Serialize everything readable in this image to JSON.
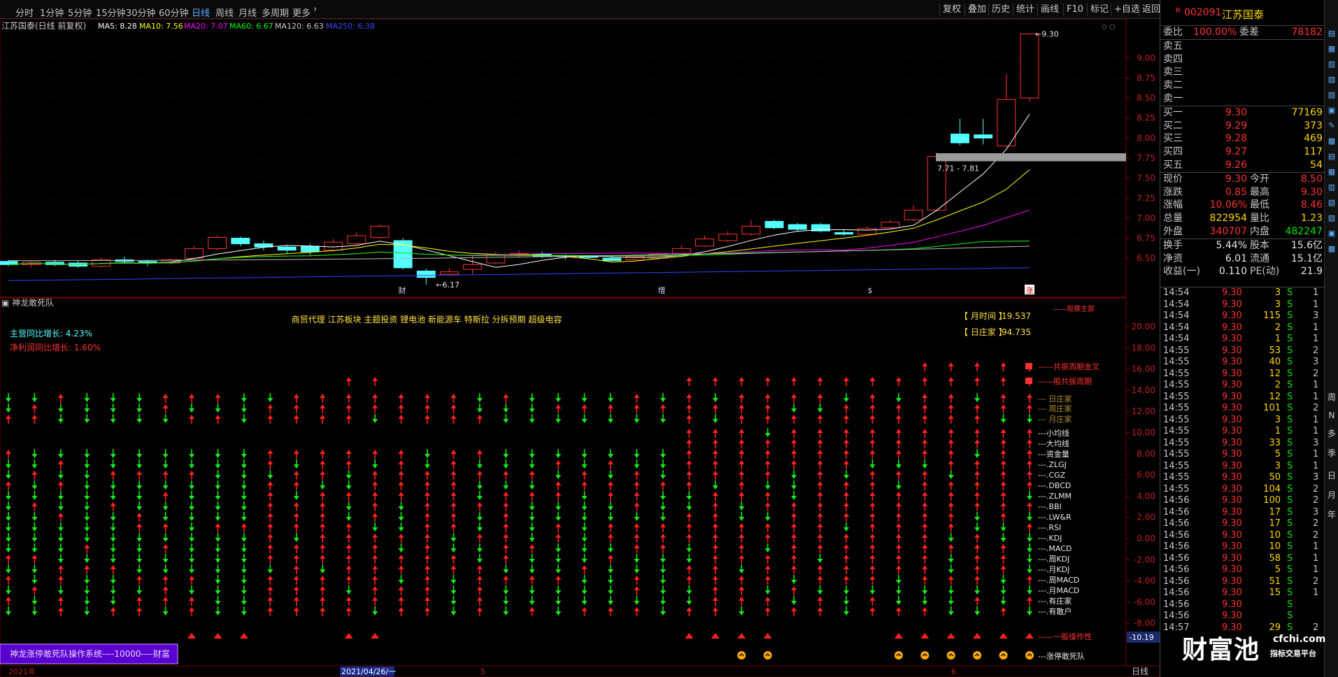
{
  "toolbar": {
    "periods": [
      "分时",
      "1分钟",
      "5分钟",
      "15分钟",
      "30分钟",
      "60分钟",
      "日线",
      "周线",
      "月线",
      "多周期",
      "更多"
    ],
    "active": "日线",
    "buttons": [
      "复权",
      "叠加",
      "历史",
      "统计",
      "画线",
      "F10",
      "标记",
      "+自选",
      "返回"
    ]
  },
  "chart": {
    "title": "江苏国泰(日线 前复权)",
    "ma": [
      {
        "label": "MA5: 8.28",
        "color": "#ffffff"
      },
      {
        "label": "MA10: 7.56",
        "color": "#ffff00"
      },
      {
        "label": "MA20: 7.07",
        "color": "#ff00ff"
      },
      {
        "label": "MA60: 6.67",
        "color": "#00ff00"
      },
      {
        "label": "MA120: 6.63",
        "color": "#cccccc"
      },
      {
        "label": "MA250: 6.38",
        "color": "#4444ff"
      }
    ],
    "price_ticks": [
      "9.00",
      "8.75",
      "8.50",
      "8.25",
      "8.00",
      "7.75",
      "7.50",
      "7.25",
      "7.00",
      "6.75",
      "6.50"
    ],
    "high_label": "9.30",
    "low_label": "6.17",
    "box_label": "7.71 - 7.81",
    "event_marks": [
      "财",
      "增",
      "$",
      "涨"
    ],
    "indicator_name": "神龙敢死队",
    "concepts": "商贸代理 江苏板块 主题投资 锂电池 新能源车 特斯拉 分拆预期 超级电容",
    "growth1": "主营同比增长: 4.23%",
    "growth2": "净利润同比增长: 1.60%",
    "top_right_label": "——观察主部",
    "info1_label": "【 月时间 】",
    "info1_val": "19.537",
    "info2_label": "【 日庄家 】",
    "info2_val": "94.735",
    "lower_ticks": [
      "20.00",
      "18.00",
      "16.00",
      "14.00",
      "12.00",
      "10.00",
      "8.00",
      "6.00",
      "4.00",
      "2.00",
      "0.00",
      "-2.00",
      "-4.00",
      "-6.00",
      "-8.00"
    ],
    "current_val": "-10.19",
    "row_labels": [
      "——共振周期金叉",
      "——般共振周期",
      "--- 日庄家",
      "--- 周庄家",
      "--- 月庄家",
      "---小均线",
      "---大均线",
      "---资金量",
      "---.ZLGJ",
      "---.CGZ",
      "---.DBCD",
      "---.ZLMM",
      "---.BBI",
      "---.LW&R",
      "---.RSI",
      "---.KDJ",
      "---.MACD",
      "---.周KDJ",
      "---.月KDJ",
      "---.周MACD",
      "---.月MACD",
      "---.有庄家",
      "---.有散户",
      "——一般操作性",
      "---涨停敢死队",
      "---涨停敢死队安全"
    ],
    "banner": "神龙涨停敢死队操作系统----10000----财富",
    "xaxis": [
      "2021年",
      "2021/04/26/一",
      "5",
      "6",
      "日线"
    ]
  },
  "quote": {
    "code": "002091",
    "name": "江苏国泰",
    "weibi_label": "委比",
    "weibi": "100.00%",
    "weicha_label": "委差",
    "weicha": "78182",
    "sell": [
      "卖五",
      "卖四",
      "卖三",
      "卖二",
      "卖一"
    ],
    "buy": [
      {
        "l": "买一",
        "p": "9.30",
        "v": "77169"
      },
      {
        "l": "买二",
        "p": "9.29",
        "v": "373"
      },
      {
        "l": "买三",
        "p": "9.28",
        "v": "469"
      },
      {
        "l": "买四",
        "p": "9.27",
        "v": "117"
      },
      {
        "l": "买五",
        "p": "9.26",
        "v": "54"
      }
    ],
    "stats": [
      {
        "a": "现价",
        "b": "9.30",
        "c": "今开",
        "d": "8.50"
      },
      {
        "a": "涨跌",
        "b": "0.85",
        "c": "最高",
        "d": "9.30"
      },
      {
        "a": "涨幅",
        "b": "10.06%",
        "c": "最低",
        "d": "8.46"
      },
      {
        "a": "总量",
        "b": "822954",
        "c": "量比",
        "d": "1.23"
      },
      {
        "a": "外盘",
        "b": "340707",
        "c": "内盘",
        "d": "482247"
      }
    ],
    "stats2": [
      {
        "a": "换手",
        "b": "5.44%",
        "c": "股本",
        "d": "15.6亿"
      },
      {
        "a": "净资",
        "b": "6.01",
        "c": "流通",
        "d": "15.1亿"
      },
      {
        "a": "收益(一)",
        "b": "0.110",
        "c": "PE(动)",
        "d": "21.9"
      }
    ],
    "ticks": [
      [
        "14:54",
        "9.30",
        "3",
        "S",
        "1"
      ],
      [
        "14:54",
        "9.30",
        "3",
        "S",
        "1"
      ],
      [
        "14:54",
        "9.30",
        "115",
        "S",
        "3"
      ],
      [
        "14:54",
        "9.30",
        "2",
        "S",
        "1"
      ],
      [
        "14:54",
        "9.30",
        "1",
        "S",
        "1"
      ],
      [
        "14:55",
        "9.30",
        "53",
        "S",
        "2"
      ],
      [
        "14:55",
        "9.30",
        "40",
        "S",
        "3"
      ],
      [
        "14:55",
        "9.30",
        "12",
        "S",
        "2"
      ],
      [
        "14:55",
        "9.30",
        "2",
        "S",
        "1"
      ],
      [
        "14:55",
        "9.30",
        "12",
        "S",
        "1"
      ],
      [
        "14:55",
        "9.30",
        "101",
        "S",
        "2"
      ],
      [
        "14:55",
        "9.30",
        "3",
        "S",
        "1"
      ],
      [
        "14:55",
        "9.30",
        "1",
        "S",
        "1"
      ],
      [
        "14:55",
        "9.30",
        "33",
        "S",
        "3"
      ],
      [
        "14:55",
        "9.30",
        "5",
        "S",
        "1"
      ],
      [
        "14:55",
        "9.30",
        "3",
        "S",
        "1"
      ],
      [
        "14:55",
        "9.30",
        "50",
        "S",
        "3"
      ],
      [
        "14:55",
        "9.30",
        "104",
        "S",
        "2"
      ],
      [
        "14:56",
        "9.30",
        "100",
        "S",
        "2"
      ],
      [
        "14:56",
        "9.30",
        "17",
        "S",
        "3"
      ],
      [
        "14:56",
        "9.30",
        "17",
        "S",
        "2"
      ],
      [
        "14:56",
        "9.30",
        "10",
        "S",
        "2"
      ],
      [
        "14:56",
        "9.30",
        "10",
        "S",
        "1"
      ],
      [
        "14:56",
        "9.30",
        "58",
        "S",
        "1"
      ],
      [
        "14:56",
        "9.30",
        "5",
        "S",
        "1"
      ],
      [
        "14:56",
        "9.30",
        "51",
        "S",
        "2"
      ],
      [
        "14:56",
        "9.30",
        "15",
        "S",
        "1"
      ],
      [
        "14:56",
        "9.30",
        "",
        "S",
        ""
      ],
      [
        "14:56",
        "9.30",
        "",
        "S",
        ""
      ],
      [
        "14:57",
        "9.30",
        "29",
        "S",
        "2"
      ]
    ]
  },
  "side_icons": [
    "周",
    "季",
    "年",
    "月",
    "日",
    "N",
    "多"
  ],
  "watermark": {
    "brand": "财富池",
    "site": "cfchi.com",
    "sub": "指标交易平台"
  },
  "chart_data": {
    "type": "candlestick",
    "candles": [
      [
        6.46,
        6.42,
        6.48,
        6.4
      ],
      [
        6.42,
        6.45,
        6.47,
        6.39
      ],
      [
        6.45,
        6.42,
        6.48,
        6.4
      ],
      [
        6.44,
        6.4,
        6.47,
        6.38
      ],
      [
        6.4,
        6.48,
        6.5,
        6.38
      ],
      [
        6.48,
        6.46,
        6.52,
        6.44
      ],
      [
        6.46,
        6.44,
        6.48,
        6.4
      ],
      [
        6.44,
        6.48,
        6.5,
        6.42
      ],
      [
        6.5,
        6.62,
        6.65,
        6.48
      ],
      [
        6.62,
        6.76,
        6.78,
        6.6
      ],
      [
        6.75,
        6.68,
        6.77,
        6.65
      ],
      [
        6.68,
        6.64,
        6.72,
        6.6
      ],
      [
        6.64,
        6.6,
        6.66,
        6.56
      ],
      [
        6.65,
        6.58,
        6.68,
        6.54
      ],
      [
        6.6,
        6.7,
        6.74,
        6.58
      ],
      [
        6.68,
        6.78,
        6.82,
        6.66
      ],
      [
        6.76,
        6.9,
        6.92,
        6.74
      ],
      [
        6.72,
        6.38,
        6.75,
        6.36
      ],
      [
        6.34,
        6.26,
        6.37,
        6.17
      ],
      [
        6.3,
        6.33,
        6.38,
        6.28
      ],
      [
        6.36,
        6.42,
        6.54,
        6.3
      ],
      [
        6.44,
        6.54,
        6.58,
        6.42
      ],
      [
        6.54,
        6.56,
        6.6,
        6.52
      ],
      [
        6.55,
        6.52,
        6.58,
        6.5
      ],
      [
        6.53,
        6.52,
        6.55,
        6.48
      ],
      [
        6.52,
        6.51,
        6.54,
        6.49
      ],
      [
        6.5,
        6.47,
        6.53,
        6.45
      ],
      [
        6.48,
        6.52,
        6.55,
        6.46
      ],
      [
        6.5,
        6.55,
        6.57,
        6.48
      ],
      [
        6.56,
        6.62,
        6.66,
        6.55
      ],
      [
        6.65,
        6.74,
        6.78,
        6.64
      ],
      [
        6.72,
        6.8,
        6.84,
        6.7
      ],
      [
        6.8,
        6.9,
        6.98,
        6.78
      ],
      [
        6.96,
        6.88,
        6.98,
        6.86
      ],
      [
        6.92,
        6.86,
        6.94,
        6.83
      ],
      [
        6.92,
        6.84,
        6.94,
        6.82
      ],
      [
        6.82,
        6.8,
        6.86,
        6.78
      ],
      [
        6.8,
        6.87,
        6.9,
        6.78
      ],
      [
        6.88,
        6.95,
        6.98,
        6.86
      ],
      [
        6.98,
        7.1,
        7.16,
        6.96
      ],
      [
        7.1,
        7.77,
        7.82,
        7.08
      ],
      [
        8.05,
        7.94,
        8.24,
        7.91
      ],
      [
        8.04,
        8.0,
        8.24,
        7.92
      ],
      [
        7.9,
        8.48,
        8.8,
        7.88
      ],
      [
        8.5,
        9.3,
        9.3,
        8.46
      ]
    ],
    "ylim": [
      6.1,
      9.4
    ]
  }
}
